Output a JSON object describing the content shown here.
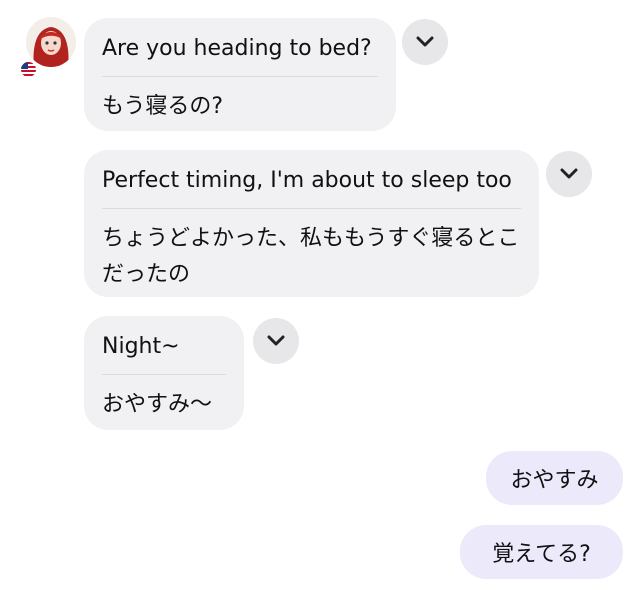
{
  "messages": {
    "m1": {
      "en": "Are you heading to bed?",
      "ja": "もう寝るの?"
    },
    "m2": {
      "en": "Perfect timing, I'm about to sleep too",
      "ja": "ちょうどよかった、私ももうすぐ寝るとこだったの"
    },
    "m3": {
      "en": "Night~",
      "ja": "おやすみ〜"
    },
    "out1": "おやすみ",
    "out2": "覚えてる?"
  },
  "icons": {
    "expand": "chevron-down-icon",
    "flag": "us-flag-icon"
  },
  "colors": {
    "incoming_bubble": "#f1f1f3",
    "outgoing_bubble": "#ece9fb",
    "chevron_button": "#e7e7ea"
  }
}
